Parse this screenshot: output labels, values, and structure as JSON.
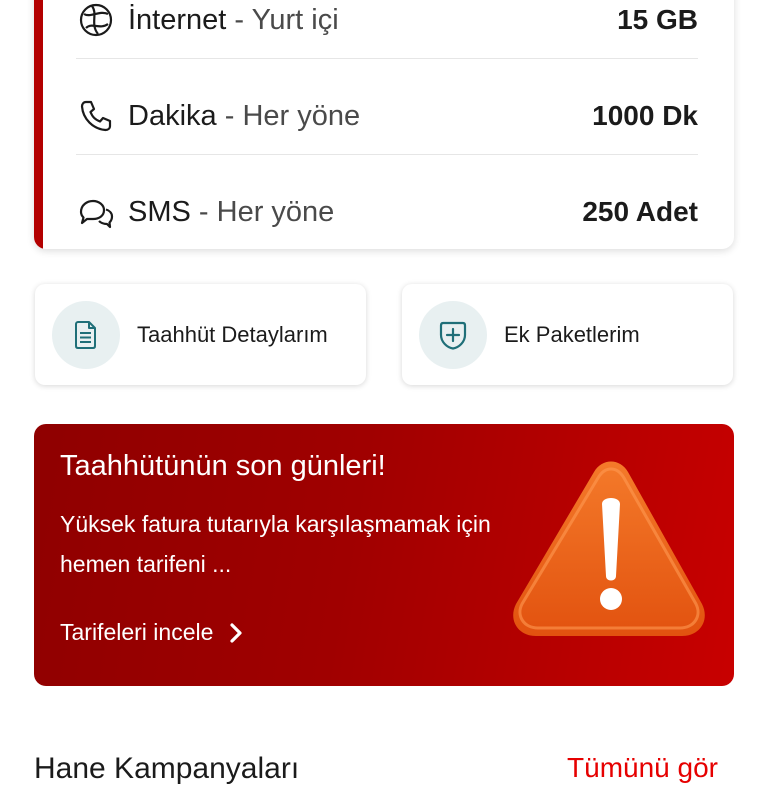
{
  "usage": {
    "rows": [
      {
        "name": "İnternet",
        "separator": "-",
        "scope": "Yurt içi",
        "value": "15 GB",
        "icon": "globe-icon"
      },
      {
        "name": "Dakika",
        "separator": "-",
        "scope": "Her yöne",
        "value": "1000 Dk",
        "icon": "phone-icon"
      },
      {
        "name": "SMS",
        "separator": "-",
        "scope": "Her yöne",
        "value": "250 Adet",
        "icon": "chat-bubbles-icon"
      }
    ]
  },
  "shortcuts": [
    {
      "label": "Taahhüt Detaylarım",
      "icon": "document-icon"
    },
    {
      "label": "Ek Paketlerim",
      "icon": "add-circle-icon"
    }
  ],
  "promo": {
    "title": "Taahhütünün son günleri!",
    "body": "Yüksek fatura tutarıyla karşılaşmamak için hemen tarifeni ...",
    "link_label": "Tarifeleri incele",
    "icon": "warning-triangle-icon"
  },
  "section": {
    "title": "Hane Kampanyaları",
    "link_label": "Tümünü gör"
  },
  "colors": {
    "accent": "#b30000",
    "promo_dark": "#8f0000",
    "promo_light": "#c80000",
    "warning_orange": "#ef6a1c",
    "icon_teal": "#1f6f78",
    "link_red": "#e60000"
  }
}
